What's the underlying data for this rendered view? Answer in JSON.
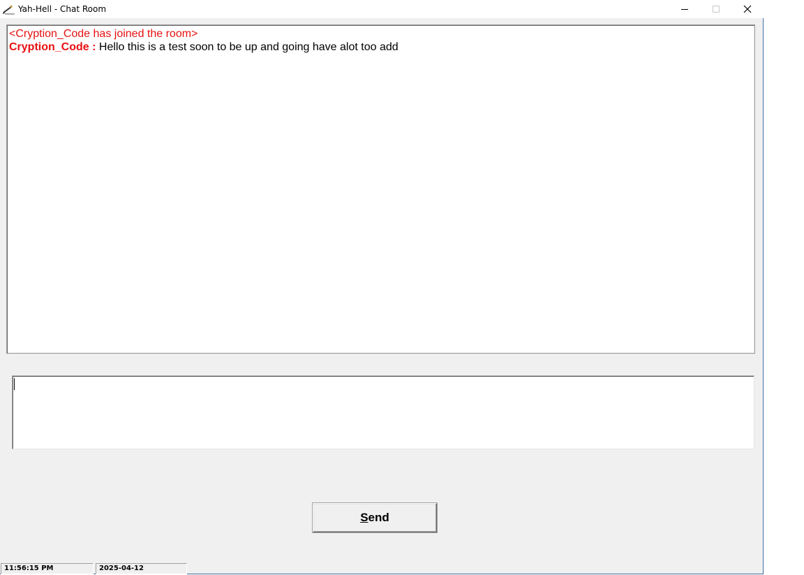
{
  "window": {
    "title": "Yah-Hell - Chat Room"
  },
  "chat": {
    "system_message": "<Cryption_Code has joined the room>",
    "messages": [
      {
        "user": "Cryption_Code :",
        "text": " Hello this is a test soon to be up and going have alot too add"
      }
    ]
  },
  "composer": {
    "value": "",
    "send_label_underlined": "S",
    "send_label_rest": "end"
  },
  "status_bar": {
    "time": "11:56:15 PM",
    "date": "2025-04-12"
  },
  "colors": {
    "system_text": "#e81010",
    "username": "#e81010",
    "message_text": "#000000"
  },
  "icons": {
    "app": "pencil-icon",
    "minimize": "minimize-icon",
    "maximize": "maximize-icon",
    "close": "close-icon"
  }
}
